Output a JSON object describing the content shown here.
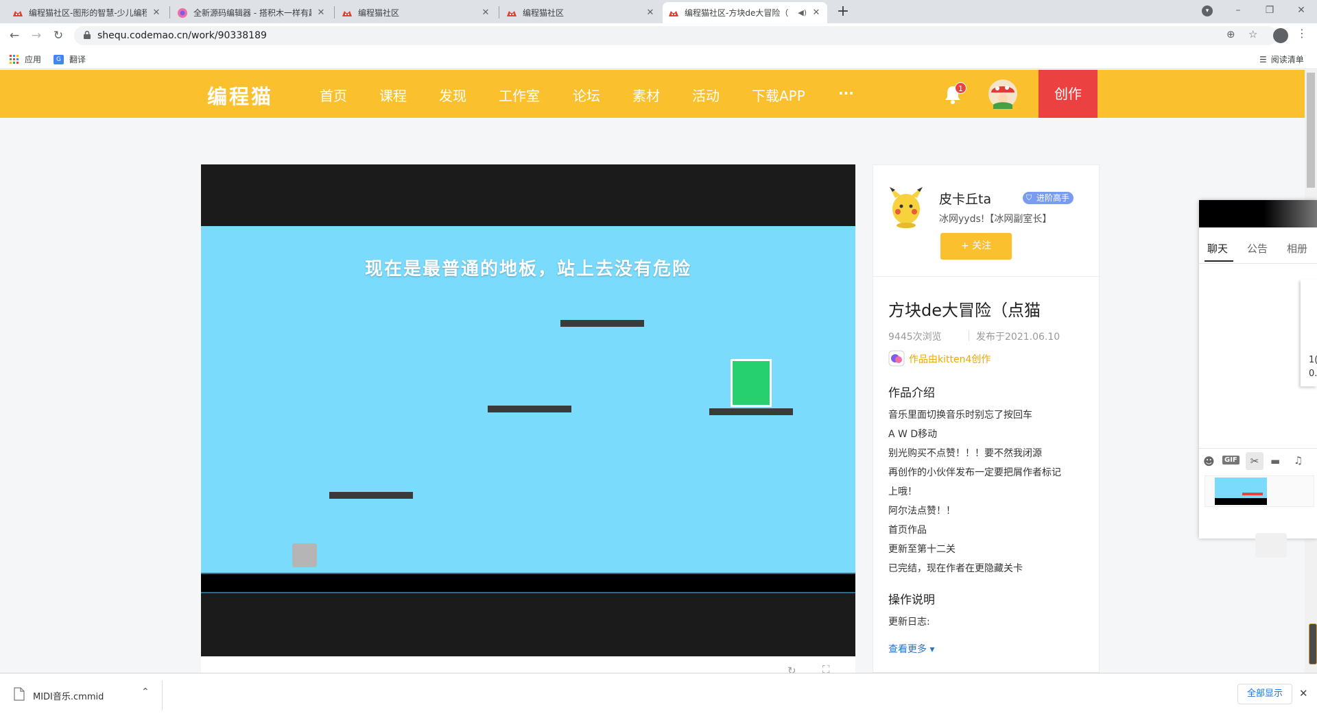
{
  "browser": {
    "tabs": [
      {
        "title": "编程猫社区-图形的智慧-少儿编程"
      },
      {
        "title": "全新源码编辑器 - 搭积木一样有趣"
      },
      {
        "title": "编程猫社区"
      },
      {
        "title": "编程猫社区"
      },
      {
        "title": "编程猫社区-方块de大冒险（"
      }
    ],
    "new_tab": "+",
    "url": "shequ.codemao.cn/work/90338189",
    "bookmarks": {
      "apps": "应用",
      "translate": "翻译",
      "reading_list": "阅读清单"
    }
  },
  "site": {
    "logo": "编程猫",
    "nav": [
      "首页",
      "课程",
      "发现",
      "工作室",
      "论坛",
      "素材",
      "活动",
      "下载APP",
      "···"
    ],
    "notification_count": "1",
    "create_label": "创作",
    "accent": "#fbc02d",
    "create_color": "#ec4141"
  },
  "game": {
    "hint_text": "现在是最普通的地板，站上去没有危险",
    "sky_color": "#7adbfc",
    "player_color": "#26d06e"
  },
  "author": {
    "name": "皮卡丘ta",
    "badge": "进阶高手",
    "bio": "冰网yyds!【冰网副室长】",
    "follow_label": "+ 关注"
  },
  "work": {
    "title": "方块de大冒险（点猫",
    "views": "9445次浏览",
    "published": "发布于2021.06.10",
    "made_with": "作品由kitten4创作",
    "intro_heading": "作品介绍",
    "intro_lines": [
      "音乐里面切换音乐时别忘了按回车",
      "A  W  D移动",
      "别光购买不点赞！！！要不然我闭源",
      "再创作的小伙伴发布一定要把屑作者标记",
      "上哦！",
      "阿尔法点赞！！",
      "首页作品",
      "更新至第十二关",
      "已完结，现在作者在更隐藏关卡"
    ],
    "ops_heading": "操作说明",
    "ops_text": "更新日志:",
    "more_label": "查看更多 ▾"
  },
  "chat": {
    "tabs": [
      "聊天",
      "公告",
      "相册"
    ],
    "side_text_1": "1(",
    "side_text_2": "0."
  },
  "download": {
    "file": "MIDI音乐.cmmid",
    "show_all": "全部显示"
  }
}
